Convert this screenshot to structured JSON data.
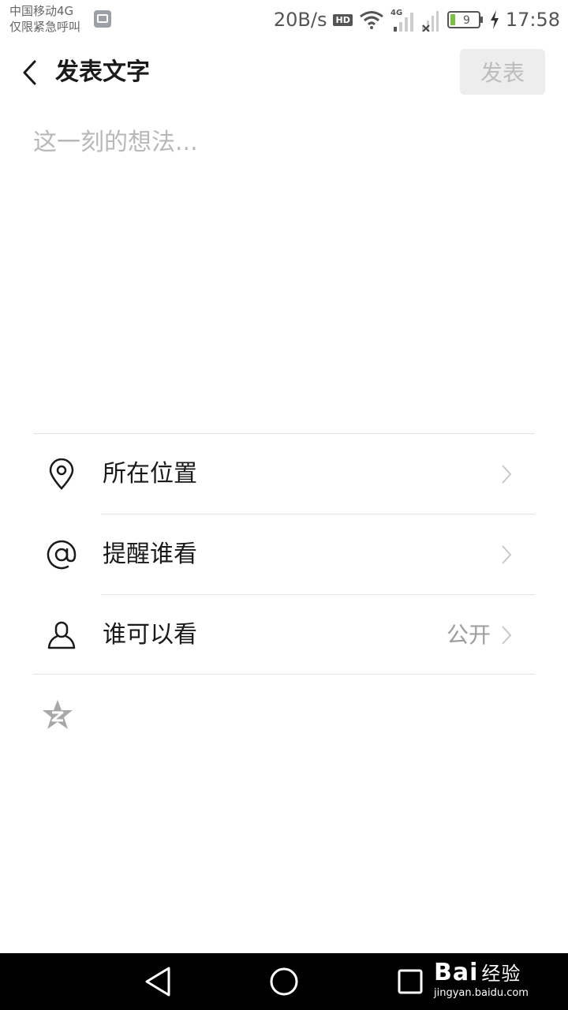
{
  "status_bar": {
    "carrier_line1": "中国移动4G",
    "carrier_line2": "仅限紧急呼叫",
    "net_speed": "20B/s",
    "hd_badge": "HD",
    "network_type": "4G",
    "battery_level": "9",
    "time": "17:58",
    "icons": [
      "image-notification-icon",
      "wifi-icon",
      "signal-icon",
      "signal-no-service-icon",
      "battery-icon",
      "charging-bolt-icon"
    ]
  },
  "header": {
    "title": "发表文字",
    "publish_label": "发表",
    "back_icon": "chevron-left-icon"
  },
  "editor": {
    "placeholder": "这一刻的想法...",
    "value": ""
  },
  "options": [
    {
      "icon": "location-pin-icon",
      "label": "所在位置",
      "value": ""
    },
    {
      "icon": "at-sign-icon",
      "label": "提醒谁看",
      "value": ""
    },
    {
      "icon": "person-icon",
      "label": "谁可以看",
      "value": "公开"
    }
  ],
  "share": {
    "icon": "qzone-star-icon"
  },
  "nav_bar": {
    "icons": [
      "nav-back-icon",
      "nav-home-icon",
      "nav-recent-icon"
    ],
    "watermark_brand": "Bai",
    "watermark_brand_suffix": "经验",
    "watermark_url": "jingyan.baidu.com"
  },
  "colors": {
    "background": "#ffffff",
    "primary_text": "#1a1a1a",
    "placeholder_text": "#b8b8b8",
    "secondary_text": "#9e9e9e",
    "publish_button_bg": "#ededed",
    "publish_button_text": "#bdbdbd",
    "divider": "#e5e5e5",
    "nav_bar_bg": "#000000"
  }
}
